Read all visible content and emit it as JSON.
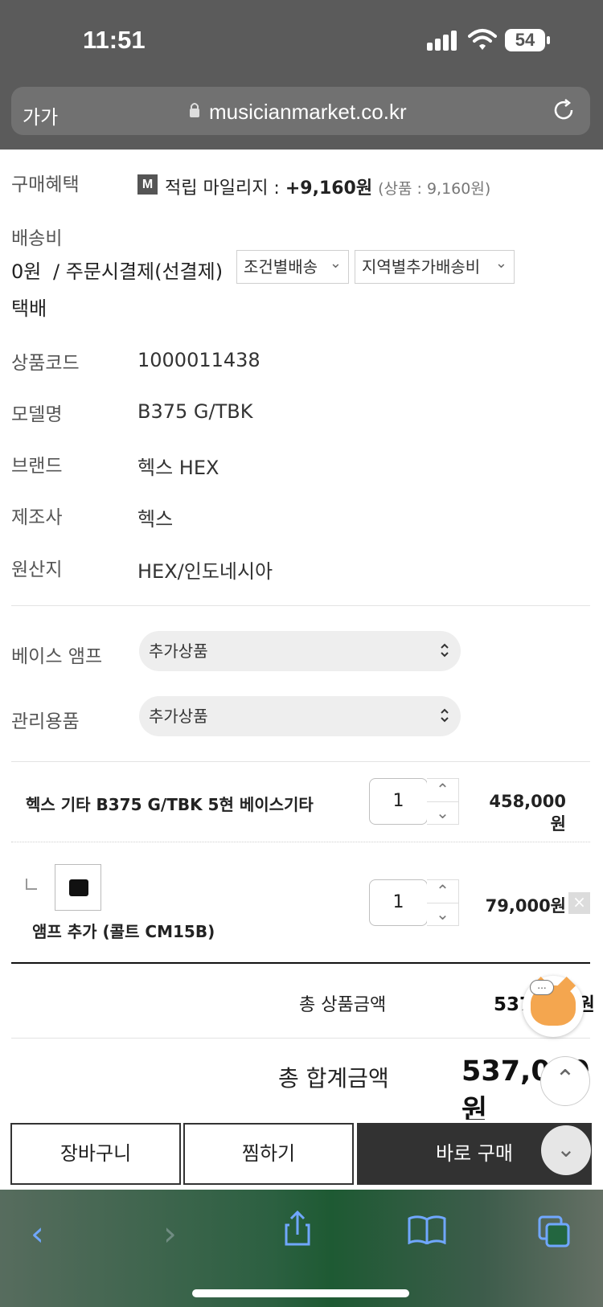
{
  "status": {
    "time": "11:51",
    "battery": "54"
  },
  "browser": {
    "text_size": "가가",
    "url": "musicianmarket.co.kr"
  },
  "product": {
    "benefit": {
      "label": "구매혜택",
      "icon_text": "M",
      "text": "적립 마일리지 : ",
      "amount": "+9,160원",
      "detail": "(상품 : 9,160원)"
    },
    "shipping": {
      "label": "배송비",
      "fee": "0원",
      "payment": "/ 주문시결제(선결제)",
      "conditional": "조건별배송",
      "regional": "지역별추가배송비",
      "method": "택배"
    },
    "info": [
      {
        "label": "상품코드",
        "value": "1000011438"
      },
      {
        "label": "모델명",
        "value": "B375 G/TBK"
      },
      {
        "label": "브랜드",
        "value": "헥스 HEX"
      },
      {
        "label": "제조사",
        "value": "헥스"
      },
      {
        "label": "원산지",
        "value": "HEX/인도네시아"
      }
    ],
    "options": [
      {
        "label": "베이스 앰프",
        "select": "추가상품"
      },
      {
        "label": "관리용품",
        "select": "추가상품"
      }
    ]
  },
  "cart": {
    "items": [
      {
        "name": "헥스 기타 B375 G/TBK 5현 베이스기타",
        "qty": "1",
        "price": "458,000원"
      },
      {
        "name": "앰프 추가 (콜트 CM15B)",
        "qty": "1",
        "price": "79,000원"
      }
    ],
    "product_total": {
      "label": "총 상품금액",
      "value": "537,000원"
    },
    "grand_total": {
      "label": "총 합계금액",
      "value": "537,000원"
    }
  },
  "buttons": {
    "cart": "장바구니",
    "wish": "찜하기",
    "buy": "바로 구매"
  },
  "icons": [
    "signal-icon",
    "wifi-icon",
    "lock-icon",
    "reload-icon",
    "back-icon",
    "forward-icon",
    "share-icon",
    "bookmarks-icon",
    "tabs-icon",
    "chevron-up-icon",
    "chevron-down-icon",
    "close-icon"
  ],
  "colors": {
    "dark_button": "#323232",
    "toolbar_icon": "#70a7ff",
    "mascot": "#f4a64f"
  }
}
